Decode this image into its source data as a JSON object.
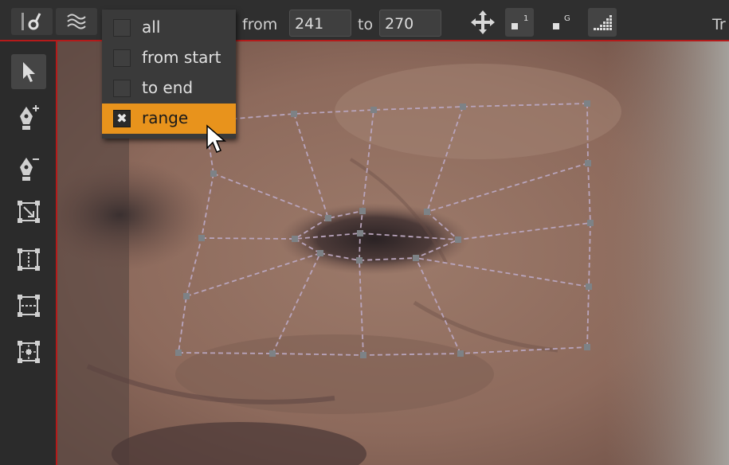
{
  "toolbar": {
    "from_label": "from",
    "from_value": "241",
    "to_label": "to",
    "to_value": "270",
    "cut_text": "Tr",
    "icons": [
      "pen-icon",
      "approx-icon",
      "move-icon",
      "keyframe-1-icon",
      "keyframe-g-icon",
      "graph-icon"
    ]
  },
  "range_menu": {
    "items": [
      {
        "label": "all",
        "checked": false
      },
      {
        "label": "from start",
        "checked": false
      },
      {
        "label": "to end",
        "checked": false
      },
      {
        "label": "range",
        "checked": true,
        "mark": "✖"
      }
    ],
    "highlight_color": "#e8931c"
  },
  "left_tools": [
    "select-arrow-icon",
    "add-point-pen-icon",
    "remove-point-pen-icon",
    "transform-box-icon",
    "grid-expand-icon",
    "grid-horizontal-icon",
    "grid-points-icon"
  ],
  "colors": {
    "accent_red": "#b51a1a",
    "grid_line": "#b8a4bc",
    "grid_point": "#7d8286"
  }
}
